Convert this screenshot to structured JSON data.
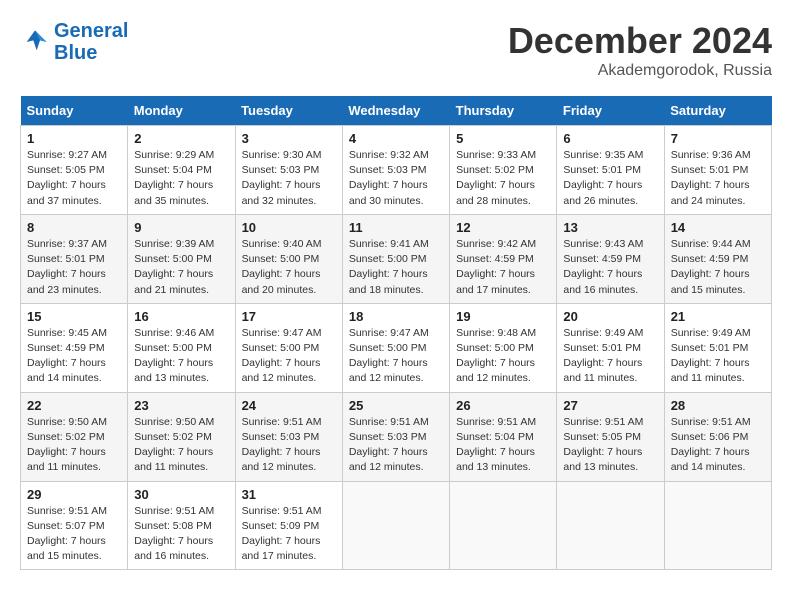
{
  "header": {
    "logo_line1": "General",
    "logo_line2": "Blue",
    "month": "December 2024",
    "location": "Akademgorodok, Russia"
  },
  "weekdays": [
    "Sunday",
    "Monday",
    "Tuesday",
    "Wednesday",
    "Thursday",
    "Friday",
    "Saturday"
  ],
  "weeks": [
    [
      {
        "day": "1",
        "sunrise": "Sunrise: 9:27 AM",
        "sunset": "Sunset: 5:05 PM",
        "daylight": "Daylight: 7 hours and 37 minutes."
      },
      {
        "day": "2",
        "sunrise": "Sunrise: 9:29 AM",
        "sunset": "Sunset: 5:04 PM",
        "daylight": "Daylight: 7 hours and 35 minutes."
      },
      {
        "day": "3",
        "sunrise": "Sunrise: 9:30 AM",
        "sunset": "Sunset: 5:03 PM",
        "daylight": "Daylight: 7 hours and 32 minutes."
      },
      {
        "day": "4",
        "sunrise": "Sunrise: 9:32 AM",
        "sunset": "Sunset: 5:03 PM",
        "daylight": "Daylight: 7 hours and 30 minutes."
      },
      {
        "day": "5",
        "sunrise": "Sunrise: 9:33 AM",
        "sunset": "Sunset: 5:02 PM",
        "daylight": "Daylight: 7 hours and 28 minutes."
      },
      {
        "day": "6",
        "sunrise": "Sunrise: 9:35 AM",
        "sunset": "Sunset: 5:01 PM",
        "daylight": "Daylight: 7 hours and 26 minutes."
      },
      {
        "day": "7",
        "sunrise": "Sunrise: 9:36 AM",
        "sunset": "Sunset: 5:01 PM",
        "daylight": "Daylight: 7 hours and 24 minutes."
      }
    ],
    [
      {
        "day": "8",
        "sunrise": "Sunrise: 9:37 AM",
        "sunset": "Sunset: 5:01 PM",
        "daylight": "Daylight: 7 hours and 23 minutes."
      },
      {
        "day": "9",
        "sunrise": "Sunrise: 9:39 AM",
        "sunset": "Sunset: 5:00 PM",
        "daylight": "Daylight: 7 hours and 21 minutes."
      },
      {
        "day": "10",
        "sunrise": "Sunrise: 9:40 AM",
        "sunset": "Sunset: 5:00 PM",
        "daylight": "Daylight: 7 hours and 20 minutes."
      },
      {
        "day": "11",
        "sunrise": "Sunrise: 9:41 AM",
        "sunset": "Sunset: 5:00 PM",
        "daylight": "Daylight: 7 hours and 18 minutes."
      },
      {
        "day": "12",
        "sunrise": "Sunrise: 9:42 AM",
        "sunset": "Sunset: 4:59 PM",
        "daylight": "Daylight: 7 hours and 17 minutes."
      },
      {
        "day": "13",
        "sunrise": "Sunrise: 9:43 AM",
        "sunset": "Sunset: 4:59 PM",
        "daylight": "Daylight: 7 hours and 16 minutes."
      },
      {
        "day": "14",
        "sunrise": "Sunrise: 9:44 AM",
        "sunset": "Sunset: 4:59 PM",
        "daylight": "Daylight: 7 hours and 15 minutes."
      }
    ],
    [
      {
        "day": "15",
        "sunrise": "Sunrise: 9:45 AM",
        "sunset": "Sunset: 4:59 PM",
        "daylight": "Daylight: 7 hours and 14 minutes."
      },
      {
        "day": "16",
        "sunrise": "Sunrise: 9:46 AM",
        "sunset": "Sunset: 5:00 PM",
        "daylight": "Daylight: 7 hours and 13 minutes."
      },
      {
        "day": "17",
        "sunrise": "Sunrise: 9:47 AM",
        "sunset": "Sunset: 5:00 PM",
        "daylight": "Daylight: 7 hours and 12 minutes."
      },
      {
        "day": "18",
        "sunrise": "Sunrise: 9:47 AM",
        "sunset": "Sunset: 5:00 PM",
        "daylight": "Daylight: 7 hours and 12 minutes."
      },
      {
        "day": "19",
        "sunrise": "Sunrise: 9:48 AM",
        "sunset": "Sunset: 5:00 PM",
        "daylight": "Daylight: 7 hours and 12 minutes."
      },
      {
        "day": "20",
        "sunrise": "Sunrise: 9:49 AM",
        "sunset": "Sunset: 5:01 PM",
        "daylight": "Daylight: 7 hours and 11 minutes."
      },
      {
        "day": "21",
        "sunrise": "Sunrise: 9:49 AM",
        "sunset": "Sunset: 5:01 PM",
        "daylight": "Daylight: 7 hours and 11 minutes."
      }
    ],
    [
      {
        "day": "22",
        "sunrise": "Sunrise: 9:50 AM",
        "sunset": "Sunset: 5:02 PM",
        "daylight": "Daylight: 7 hours and 11 minutes."
      },
      {
        "day": "23",
        "sunrise": "Sunrise: 9:50 AM",
        "sunset": "Sunset: 5:02 PM",
        "daylight": "Daylight: 7 hours and 11 minutes."
      },
      {
        "day": "24",
        "sunrise": "Sunrise: 9:51 AM",
        "sunset": "Sunset: 5:03 PM",
        "daylight": "Daylight: 7 hours and 12 minutes."
      },
      {
        "day": "25",
        "sunrise": "Sunrise: 9:51 AM",
        "sunset": "Sunset: 5:03 PM",
        "daylight": "Daylight: 7 hours and 12 minutes."
      },
      {
        "day": "26",
        "sunrise": "Sunrise: 9:51 AM",
        "sunset": "Sunset: 5:04 PM",
        "daylight": "Daylight: 7 hours and 13 minutes."
      },
      {
        "day": "27",
        "sunrise": "Sunrise: 9:51 AM",
        "sunset": "Sunset: 5:05 PM",
        "daylight": "Daylight: 7 hours and 13 minutes."
      },
      {
        "day": "28",
        "sunrise": "Sunrise: 9:51 AM",
        "sunset": "Sunset: 5:06 PM",
        "daylight": "Daylight: 7 hours and 14 minutes."
      }
    ],
    [
      {
        "day": "29",
        "sunrise": "Sunrise: 9:51 AM",
        "sunset": "Sunset: 5:07 PM",
        "daylight": "Daylight: 7 hours and 15 minutes."
      },
      {
        "day": "30",
        "sunrise": "Sunrise: 9:51 AM",
        "sunset": "Sunset: 5:08 PM",
        "daylight": "Daylight: 7 hours and 16 minutes."
      },
      {
        "day": "31",
        "sunrise": "Sunrise: 9:51 AM",
        "sunset": "Sunset: 5:09 PM",
        "daylight": "Daylight: 7 hours and 17 minutes."
      },
      null,
      null,
      null,
      null
    ]
  ]
}
